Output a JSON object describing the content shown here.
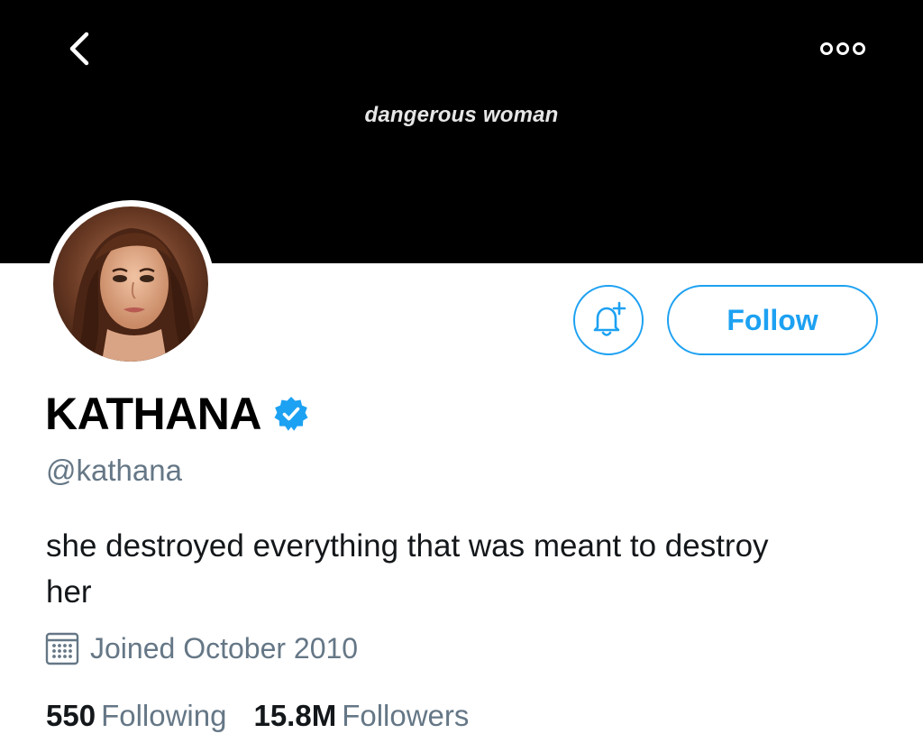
{
  "header": {
    "banner_text": "dangerous woman",
    "back_icon": "chevron-left-icon",
    "more_icon": "more-horizontal-icon"
  },
  "profile": {
    "display_name": "KATHANA",
    "handle": "@kathana",
    "bio": "she destroyed everything that was meant to destroy her",
    "joined": "Joined October 2010",
    "verified": true
  },
  "actions": {
    "follow_label": "Follow",
    "notify_icon": "bell-plus-icon"
  },
  "stats": {
    "following_count": "550",
    "following_label": "Following",
    "followers_count": "15.8M",
    "followers_label": "Followers"
  },
  "colors": {
    "accent": "#1da1f2",
    "secondary_text": "#657786",
    "banner_bg": "#000000"
  }
}
